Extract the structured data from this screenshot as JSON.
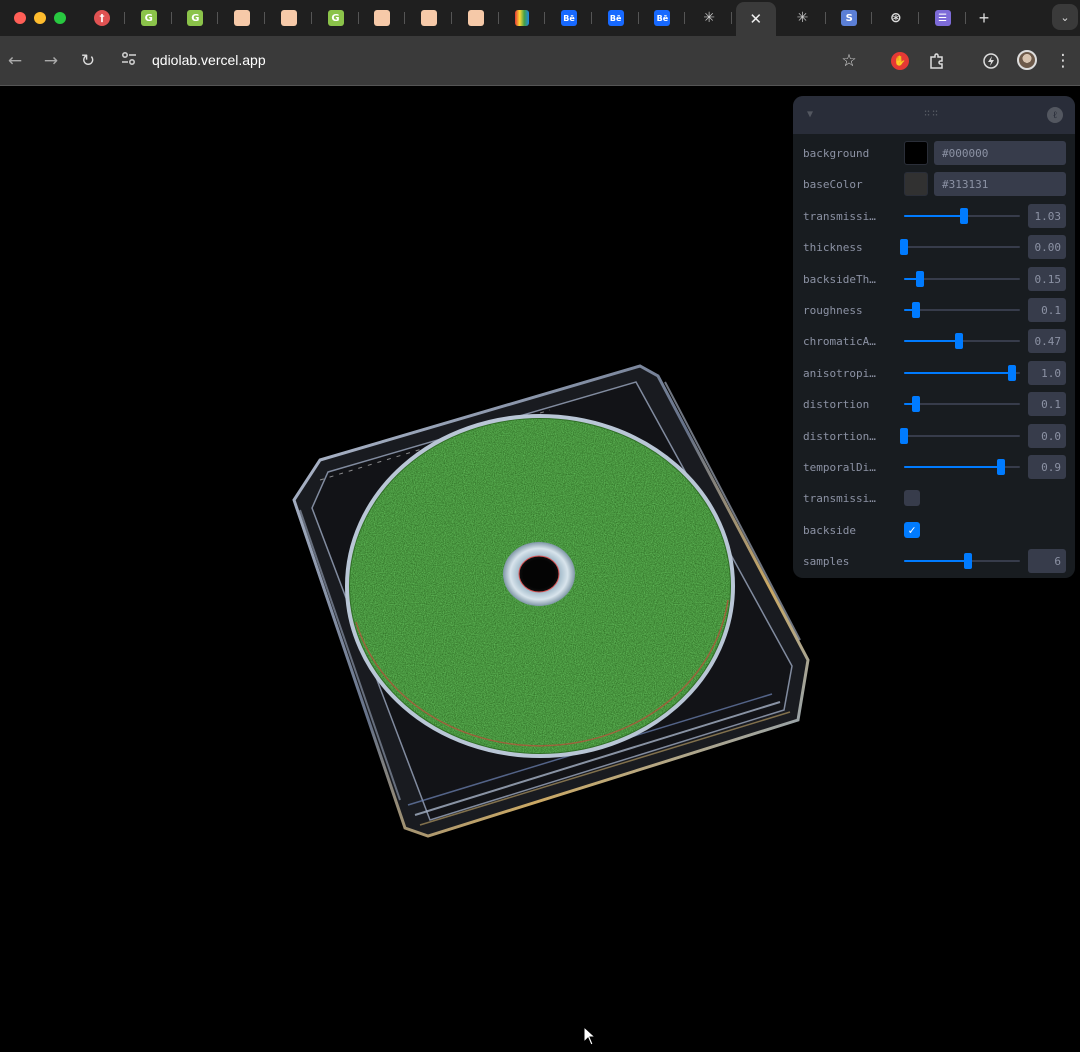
{
  "browser": {
    "tabs": [
      {
        "icon": "red-circle-icon",
        "glyph": "†"
      },
      {
        "icon": "green-g-icon",
        "glyph": "G"
      },
      {
        "icon": "green-g-icon",
        "glyph": "G"
      },
      {
        "icon": "peach-square-icon",
        "glyph": ""
      },
      {
        "icon": "peach-square-icon",
        "glyph": ""
      },
      {
        "icon": "green-g-icon",
        "glyph": "G"
      },
      {
        "icon": "peach-square-icon",
        "glyph": ""
      },
      {
        "icon": "peach-square-icon",
        "glyph": ""
      },
      {
        "icon": "peach-square-icon",
        "glyph": ""
      },
      {
        "icon": "rainbow-icon",
        "glyph": ""
      },
      {
        "icon": "behance-icon",
        "glyph": "Bē"
      },
      {
        "icon": "behance-icon",
        "glyph": "Bē"
      },
      {
        "icon": "behance-icon",
        "glyph": "Bē"
      },
      {
        "icon": "asterisk-icon",
        "glyph": "✳"
      },
      {
        "icon": "close-icon",
        "glyph": "✕",
        "active": true
      },
      {
        "icon": "asterisk-icon",
        "glyph": "✳"
      },
      {
        "icon": "s-icon",
        "glyph": "S"
      },
      {
        "icon": "chatgpt-icon",
        "glyph": "⊛"
      },
      {
        "icon": "list-icon",
        "glyph": "☰"
      }
    ],
    "new_tab_glyph": "+",
    "tab_search_glyph": "⌄",
    "url": "qdiolab.vercel.app"
  },
  "panel": {
    "rows": [
      {
        "type": "color",
        "label": "background",
        "hex": "#000000",
        "swatch": "#000000"
      },
      {
        "type": "color",
        "label": "baseColor",
        "hex": "#313131",
        "swatch": "#313131"
      },
      {
        "type": "slider",
        "label": "transmissi…",
        "value": "1.03",
        "fraction": 0.52
      },
      {
        "type": "slider",
        "label": "thickness",
        "value": "0.00",
        "fraction": 0.0
      },
      {
        "type": "slider",
        "label": "backsideTh…",
        "value": "0.15",
        "fraction": 0.14
      },
      {
        "type": "slider",
        "label": "roughness",
        "value": "0.1",
        "fraction": 0.1
      },
      {
        "type": "slider",
        "label": "chromaticA…",
        "value": "0.47",
        "fraction": 0.47
      },
      {
        "type": "slider",
        "label": "anisotropi…",
        "value": "1.0",
        "fraction": 0.93
      },
      {
        "type": "slider",
        "label": "distortion",
        "value": "0.1",
        "fraction": 0.1
      },
      {
        "type": "slider",
        "label": "distortion…",
        "value": "0.0",
        "fraction": 0.0
      },
      {
        "type": "slider",
        "label": "temporalDi…",
        "value": "0.9",
        "fraction": 0.84
      },
      {
        "type": "checkbox",
        "label": "transmissi…",
        "checked": false
      },
      {
        "type": "checkbox",
        "label": "backside",
        "checked": true
      },
      {
        "type": "slider",
        "label": "samples",
        "value": "6",
        "fraction": 0.55
      }
    ]
  },
  "colors": {
    "accent": "#007bff",
    "grass": "#3f9a2a"
  }
}
